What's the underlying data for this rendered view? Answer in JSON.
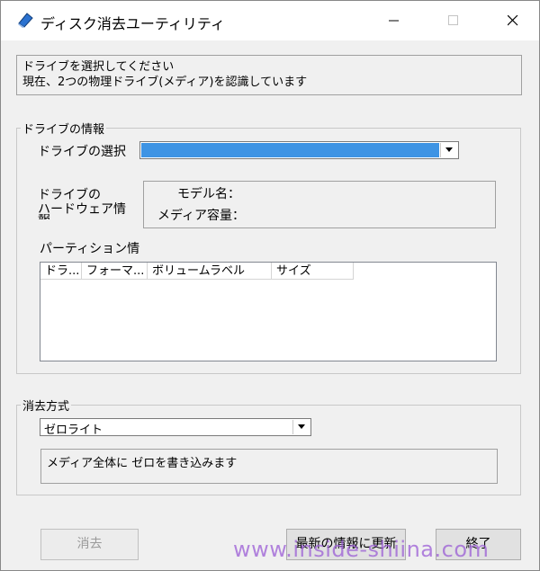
{
  "window": {
    "title": "ディスク消去ユーティリティ",
    "icon": "disk-eraser-app-icon"
  },
  "message": {
    "line1": "ドライブを選択してください",
    "line2": "現在、2つの物理ドライブ(メディア)を認識しています"
  },
  "drive_group": {
    "legend": "ドライブの情報",
    "select_label": "ドライブの選択",
    "selected_drive": "",
    "hw_label_line1": "ドライブの",
    "hw_label_line2": "ハードウェア情",
    "hw_label_line3": "報",
    "model_label": "モデル名：",
    "capacity_label": "メディア容量：",
    "partition_label": "パーティション情",
    "columns": [
      "ドラ...",
      "フォーマ...",
      "ボリュームラベル",
      "サイズ"
    ]
  },
  "method_group": {
    "legend": "消去方式",
    "selected_method": "ゼロライト",
    "description": "メディア全体に ゼロを書き込みます"
  },
  "buttons": {
    "erase": "消去",
    "refresh": "最新の情報に更新",
    "exit": "終了"
  },
  "watermark": "www.inside-shiina.com",
  "colors": {
    "selection_highlight": "#3e94e4",
    "window_bg": "#f0f0f0",
    "watermark": "#9b5dd6"
  }
}
